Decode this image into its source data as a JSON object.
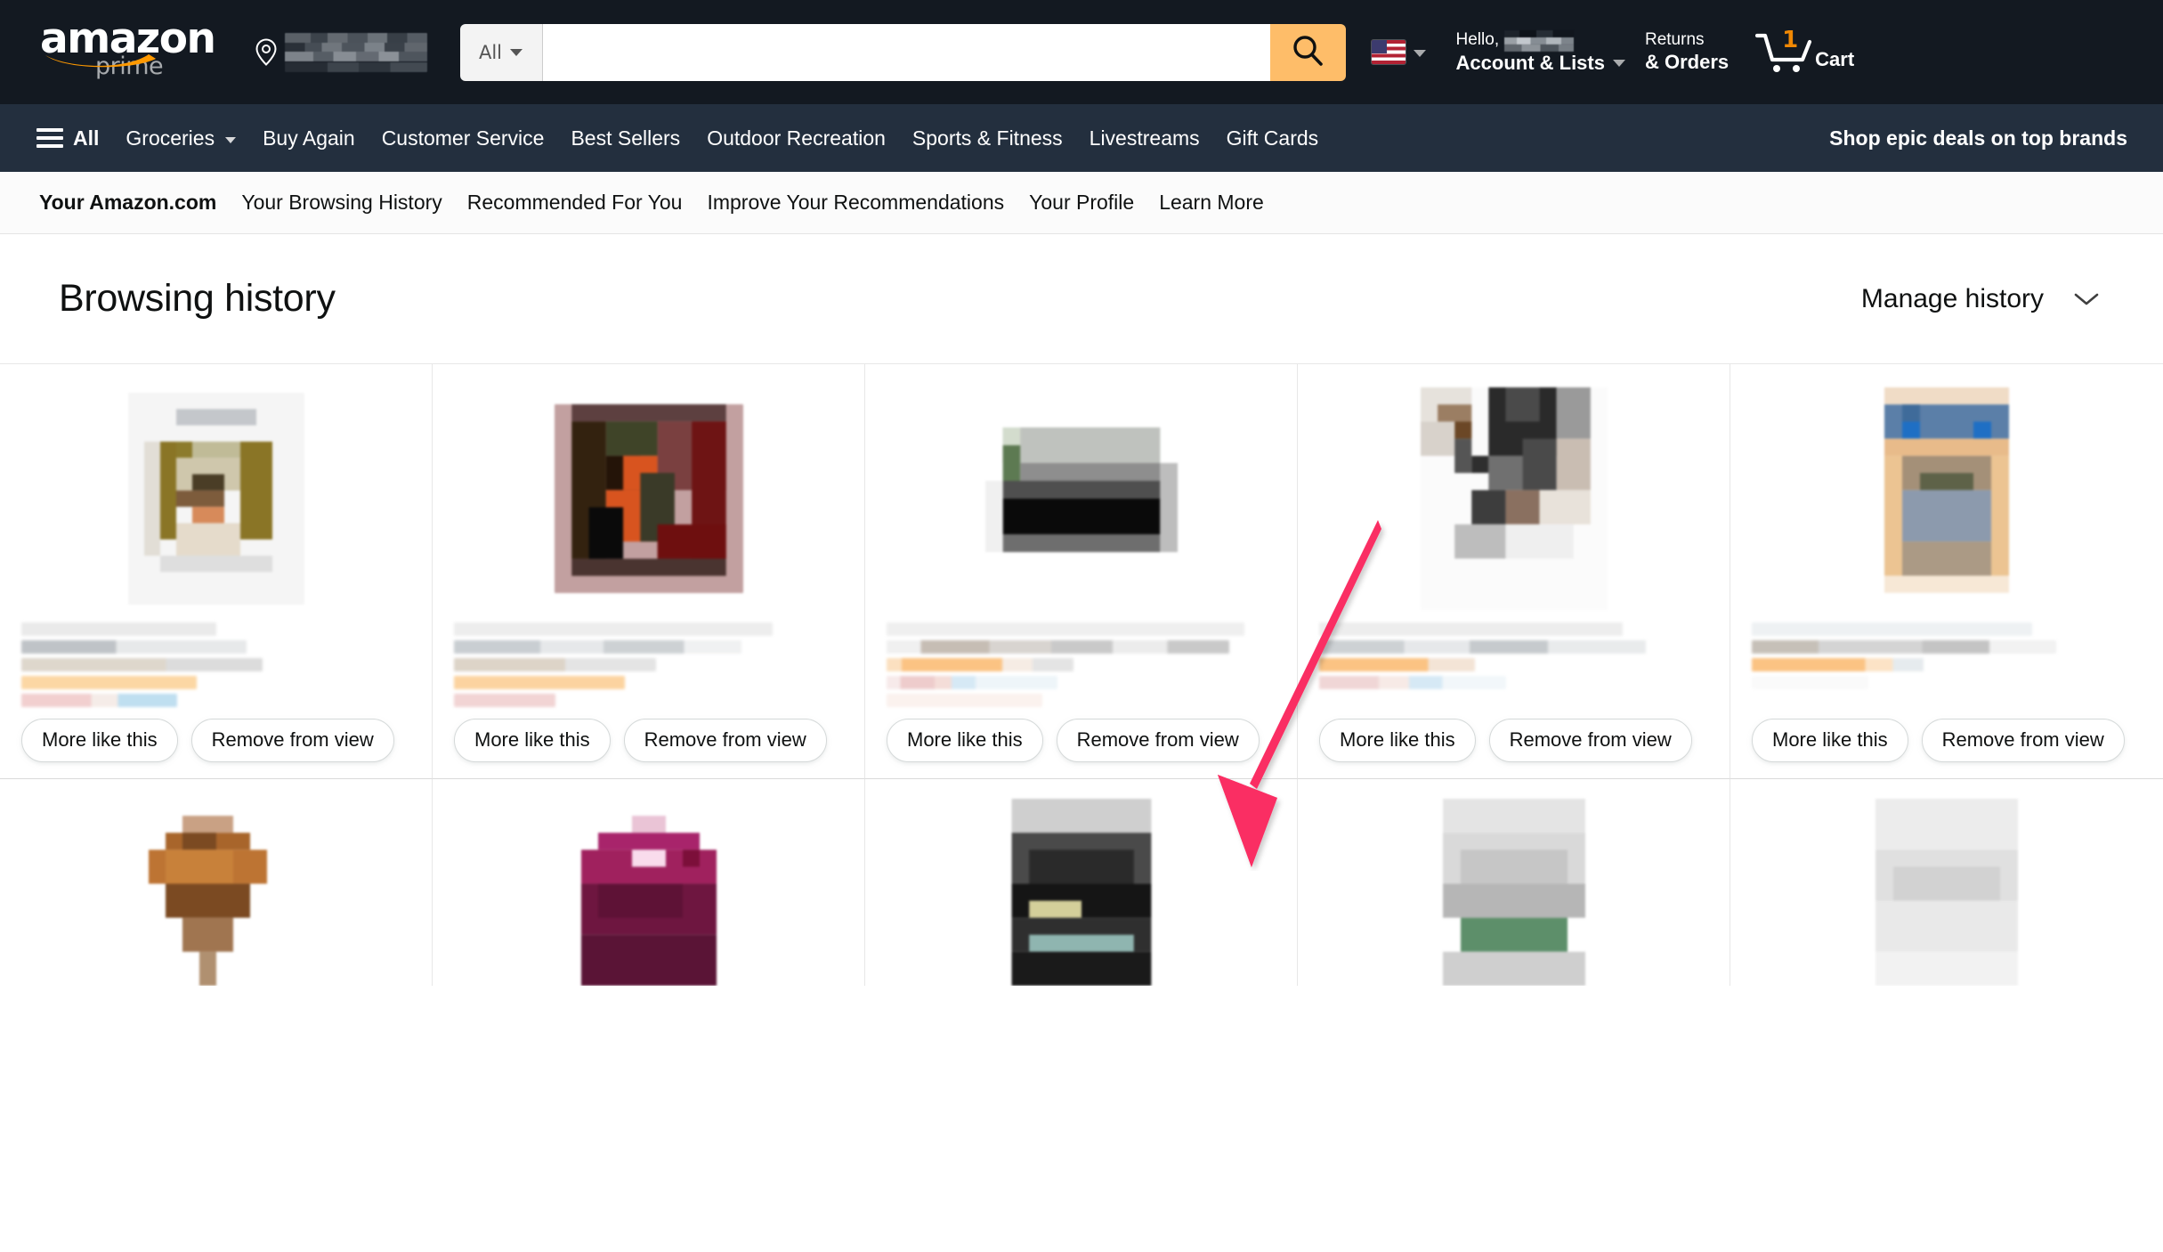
{
  "header": {
    "logo_word": "amazon",
    "logo_sub": "prime",
    "location_icon": "map-pin-icon",
    "location_value_redacted": true,
    "search": {
      "category": "All",
      "value": "",
      "placeholder": "",
      "button_icon": "search-icon"
    },
    "locale": {
      "flag": "us-flag-icon",
      "caret": "chevron-down-icon"
    },
    "account": {
      "greeting": "Hello,",
      "name_redacted": true,
      "label": "Account & Lists"
    },
    "returns": {
      "line1": "Returns",
      "line2": "& Orders"
    },
    "cart": {
      "count": "1",
      "label": "Cart",
      "icon": "shopping-cart-icon"
    }
  },
  "main_nav": {
    "all_label": "All",
    "items": [
      {
        "label": "Groceries",
        "has_caret": true
      },
      {
        "label": "Buy Again",
        "has_caret": false
      },
      {
        "label": "Customer Service",
        "has_caret": false
      },
      {
        "label": "Best Sellers",
        "has_caret": false
      },
      {
        "label": "Outdoor Recreation",
        "has_caret": false
      },
      {
        "label": "Sports & Fitness",
        "has_caret": false
      },
      {
        "label": "Livestreams",
        "has_caret": false
      },
      {
        "label": "Gift Cards",
        "has_caret": false
      }
    ],
    "promo": "Shop epic deals on top brands"
  },
  "sub_nav": {
    "items": [
      {
        "label": "Your Amazon.com",
        "active": true
      },
      {
        "label": "Your Browsing History",
        "active": false
      },
      {
        "label": "Recommended For You",
        "active": false
      },
      {
        "label": "Improve Your Recommendations",
        "active": false
      },
      {
        "label": "Your Profile",
        "active": false
      },
      {
        "label": "Learn More",
        "active": false
      }
    ]
  },
  "page": {
    "title": "Browsing history",
    "manage_label": "Manage history",
    "manage_caret_icon": "chevron-down-icon"
  },
  "buttons": {
    "more_like_this": "More like this",
    "remove_from_view": "Remove from view"
  },
  "products_row1": [
    {
      "name": "product-card-1",
      "redacted": true,
      "img_palette": [
        "#8a7526",
        "#c9c4a3",
        "#6b523c",
        "#d78a5a",
        "#eae3d6"
      ]
    },
    {
      "name": "product-card-2",
      "redacted": true,
      "img_palette": [
        "#5d3030",
        "#2b2b18",
        "#d8541f",
        "#7a1414",
        "#c2a0a0"
      ]
    },
    {
      "name": "product-card-3",
      "redacted": true,
      "img_palette": [
        "#b9bcb6",
        "#8c8c8c",
        "#0a0a0a",
        "#5d6b52",
        "#dcdcdc"
      ]
    },
    {
      "name": "product-card-4",
      "redacted": true,
      "img_palette": [
        "#8a7060",
        "#2f2f2f",
        "#6b6b6b",
        "#c9b8ab",
        "#1a1a1a"
      ]
    },
    {
      "name": "product-card-5",
      "redacted": true,
      "img_palette": [
        "#3f7bc0",
        "#e8bb8a",
        "#8c9aad",
        "#a49078",
        "#f5e0c8"
      ]
    }
  ],
  "products_row2": [
    {
      "name": "product-card-6",
      "redacted": true,
      "img_palette": [
        "#a8652b",
        "#7b4a22",
        "#c9a184",
        "#f3efe9"
      ]
    },
    {
      "name": "product-card-7",
      "redacted": true,
      "img_palette": [
        "#a8246b",
        "#5e1236",
        "#e8c0d4",
        "#7c1b45"
      ]
    },
    {
      "name": "product-card-8",
      "redacted": true,
      "img_palette": [
        "#4a4a4a",
        "#151515",
        "#8fb5b0",
        "#d4cf9a"
      ]
    },
    {
      "name": "product-card-9",
      "redacted": true,
      "img_palette": [
        "#d9d9d9",
        "#9aa39a",
        "#5d8f6a",
        "#bfbfbf"
      ]
    },
    {
      "name": "product-card-10",
      "redacted": true,
      "img_palette": [
        "#ececec",
        "#d6d6d6",
        "#f5f5f5",
        "#c4c4c4"
      ]
    }
  ],
  "annotation": {
    "type": "arrow",
    "color": "#fa2d63",
    "points_to": "remove-from-view-button-card-3",
    "direction": "down-left"
  },
  "colors": {
    "header_bg": "#131921",
    "nav_bg": "#232f3e",
    "search_button": "#febd69",
    "accent_orange": "#f08804",
    "arrow_pink": "#fa2d63"
  }
}
